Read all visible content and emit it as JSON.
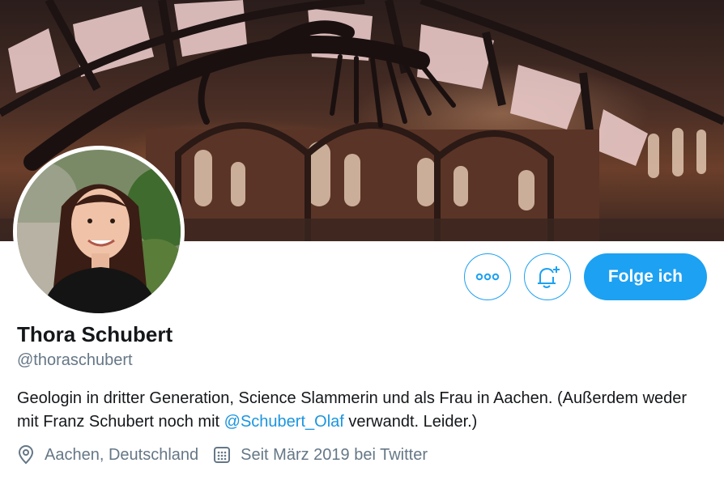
{
  "profile": {
    "name": "Thora Schubert",
    "handle": "@thoraschubert",
    "bio": {
      "text_before": "Geologin in dritter Generation, Science Slammerin und als Frau in Aachen.  (Außerdem weder mit Franz Schubert noch mit ",
      "mention": "@Schubert_Olaf",
      "text_after": " verwandt. Leider.)"
    },
    "location": "Aachen, Deutschland",
    "joined": "Seit März 2019 bei Twitter"
  },
  "actions": {
    "more_icon": "more-horizontal-icon",
    "notify_icon": "bell-plus-icon",
    "follow_label": "Folge ich"
  },
  "colors": {
    "accent": "#1da1f2",
    "text": "#14171a",
    "secondary": "#657786",
    "link": "#1b95e0"
  }
}
